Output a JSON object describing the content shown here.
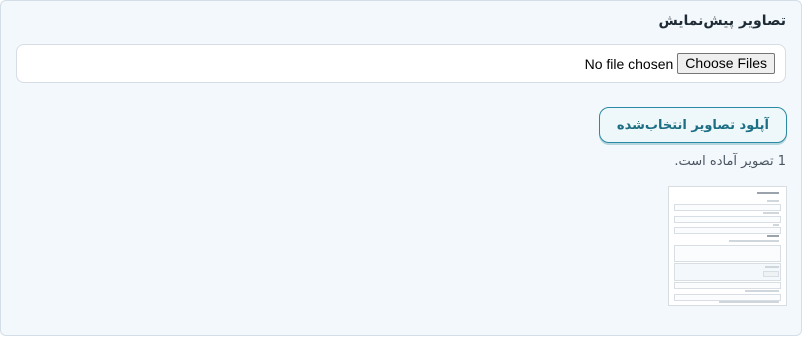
{
  "section": {
    "title": "تصاویر پیش‌نمایش"
  },
  "file_input": {
    "button_label": "Choose Files",
    "status_text": "No file chosen"
  },
  "upload": {
    "button_label": "آپلود تصاویر انتخاب‌شده"
  },
  "status": {
    "ready_text": "1 تصویر آماده است."
  },
  "colors": {
    "panel_bg": "#f3f8fc",
    "accent": "#2b8aa3",
    "accent_text": "#1b6e83"
  }
}
